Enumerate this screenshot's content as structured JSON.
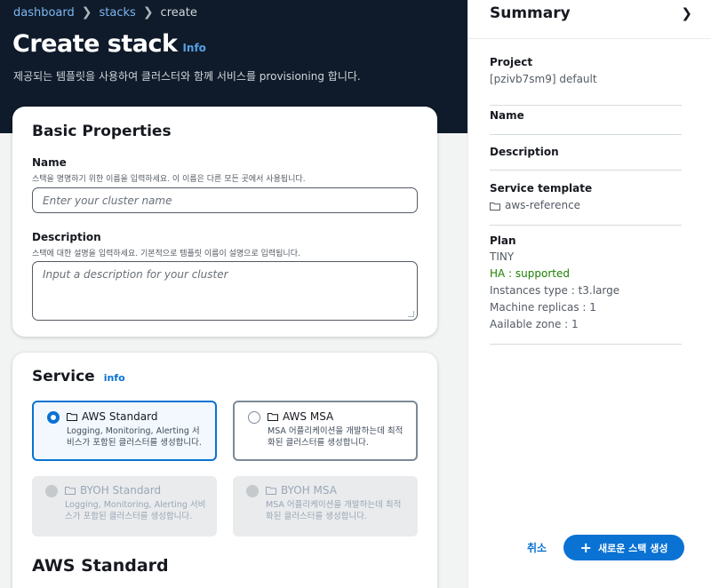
{
  "breadcrumb": {
    "items": [
      "dashboard",
      "stacks"
    ],
    "current": "create"
  },
  "header": {
    "title": "Create stack",
    "info_label": "Info",
    "subtitle": "제공되는 템플릿을 사용하여 클러스터와 함께 서비스를 provisioning 합니다."
  },
  "basic": {
    "title": "Basic Properties",
    "name_label": "Name",
    "name_hint": "스택을 명명하기 위한 이름을 입력하세요. 이 이름은 다른 모든 곳에서 사용됩니다.",
    "name_placeholder": "Enter your cluster name",
    "desc_label": "Description",
    "desc_hint": "스택에 대한 설명을 입력하세요. 기본적으로 템플릿 이름이 설명으로 입력됩니다.",
    "desc_placeholder": "Input a description for your cluster"
  },
  "service": {
    "title": "Service",
    "info_label": "info",
    "options": [
      {
        "label": "AWS Standard",
        "desc": "Logging, Monitoring, Alerting 서비스가 포함된 클러스터를 생성합니다.",
        "state": "selected"
      },
      {
        "label": "AWS MSA",
        "desc": "MSA 어플리케이션을 개발하는데 최적화된 클러스터를 생성합니다.",
        "state": "normal"
      },
      {
        "label": "BYOH Standard",
        "desc": "Logging, Monitoring, Alerting 서비스가 포함된 클러스터를 생성합니다.",
        "state": "disabled"
      },
      {
        "label": "BYOH MSA",
        "desc": "MSA 어플리케이션을 개발하는데 최적화된 클러스터를 생성합니다.",
        "state": "disabled"
      }
    ]
  },
  "next_section": {
    "title": "AWS Standard"
  },
  "summary": {
    "title": "Summary",
    "project_label": "Project",
    "project_value": "[pzivb7sm9] default",
    "name_label": "Name",
    "description_label": "Description",
    "template_label": "Service template",
    "template_value": "aws-reference",
    "plan_label": "Plan",
    "plan_tier": "TINY",
    "plan_ha": "HA : supported",
    "plan_instance": "Instances type : t3.large",
    "plan_replicas": "Machine replicas : 1",
    "plan_zone": "Aailable zone : 1"
  },
  "actions": {
    "cancel": "취소",
    "create": "새로운 스택 생성"
  },
  "colors": {
    "accent": "#0972d3",
    "hero": "#0f1b2a",
    "success": "#1d8102"
  },
  "icons": [
    "chevron-right-icon",
    "folder-icon",
    "plus-icon",
    "drag-handle-icon"
  ]
}
